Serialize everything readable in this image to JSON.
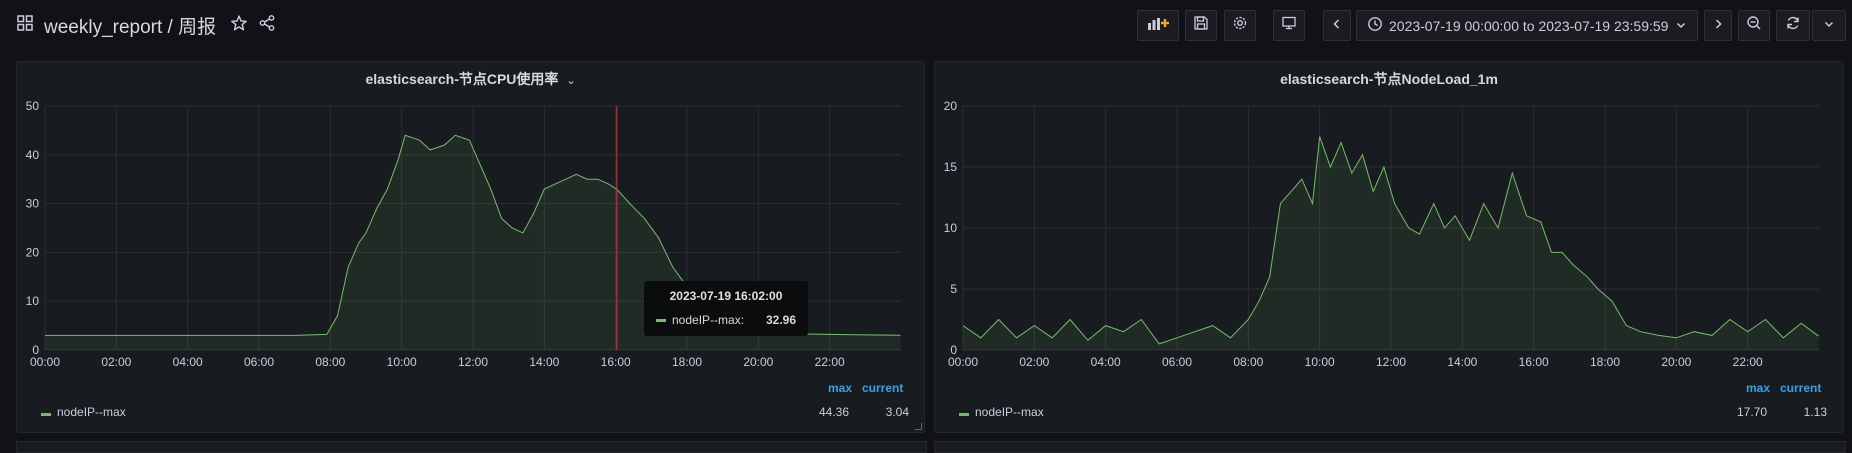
{
  "dashboard": {
    "title": "weekly_report / 周报"
  },
  "toolbar": {
    "time_range": "2023-07-19 00:00:00 to 2023-07-19 23:59:59",
    "icons": [
      "add-panel-icon",
      "save-icon",
      "settings-icon",
      "tv-mode-icon",
      "prev-time-icon",
      "clock-icon",
      "next-time-icon",
      "zoom-out-icon",
      "refresh-icon",
      "refresh-interval-chevron-icon"
    ]
  },
  "colors": {
    "series": "#73bf69",
    "crosshair": "#e02f44",
    "legend_header": "#33a2e5"
  },
  "panels": [
    {
      "title": "elasticsearch-节点CPU使用率",
      "legend": {
        "headers": {
          "max": "max",
          "current": "current"
        },
        "series_name": "nodeIP--max",
        "max": "44.36",
        "current": "3.04"
      },
      "tooltip": {
        "time": "2023-07-19 16:02:00",
        "series": "nodeIP--max:",
        "value": "32.96"
      }
    },
    {
      "title": "elasticsearch-节点NodeLoad_1m",
      "legend": {
        "headers": {
          "max": "max",
          "current": "current"
        },
        "series_name": "nodeIP--max",
        "max": "17.70",
        "current": "1.13"
      }
    }
  ],
  "chart_data": [
    {
      "type": "area",
      "title": "elasticsearch-节点CPU使用率",
      "x_tick_labels": [
        "00:00",
        "02:00",
        "04:00",
        "06:00",
        "08:00",
        "10:00",
        "12:00",
        "14:00",
        "16:00",
        "18:00",
        "20:00",
        "22:00"
      ],
      "y_tick_labels": [
        "0",
        "10",
        "20",
        "30",
        "40",
        "50"
      ],
      "ylim": [
        0,
        50
      ],
      "xlim_hours": [
        0,
        24
      ],
      "grid": true,
      "series": [
        {
          "name": "nodeIP--max",
          "points": [
            [
              0,
              3
            ],
            [
              1,
              3
            ],
            [
              2,
              3
            ],
            [
              3,
              3
            ],
            [
              4,
              3
            ],
            [
              5,
              3
            ],
            [
              6,
              3
            ],
            [
              7,
              3
            ],
            [
              7.9,
              3.2
            ],
            [
              8.2,
              7
            ],
            [
              8.5,
              17
            ],
            [
              8.8,
              22
            ],
            [
              9,
              24
            ],
            [
              9.3,
              29
            ],
            [
              9.6,
              33
            ],
            [
              9.9,
              39
            ],
            [
              10.1,
              44
            ],
            [
              10.5,
              43
            ],
            [
              10.8,
              41
            ],
            [
              11.2,
              42
            ],
            [
              11.5,
              44
            ],
            [
              11.9,
              43
            ],
            [
              12.2,
              38
            ],
            [
              12.5,
              33
            ],
            [
              12.8,
              27
            ],
            [
              13.1,
              25
            ],
            [
              13.4,
              24
            ],
            [
              13.7,
              28
            ],
            [
              14,
              33
            ],
            [
              14.3,
              34
            ],
            [
              14.6,
              35
            ],
            [
              14.9,
              36
            ],
            [
              15.2,
              35
            ],
            [
              15.5,
              35
            ],
            [
              15.8,
              34
            ],
            [
              16.03,
              32.96
            ],
            [
              16.4,
              30
            ],
            [
              16.8,
              27
            ],
            [
              17.2,
              23
            ],
            [
              17.6,
              17
            ],
            [
              18,
              13
            ],
            [
              18.5,
              7
            ],
            [
              19,
              4
            ],
            [
              20,
              3.2
            ],
            [
              21,
              3.3
            ],
            [
              22,
              3.2
            ],
            [
              23,
              3.1
            ],
            [
              23.99,
              3.04
            ]
          ]
        }
      ]
    },
    {
      "type": "area",
      "title": "elasticsearch-节点NodeLoad_1m",
      "x_tick_labels": [
        "00:00",
        "02:00",
        "04:00",
        "06:00",
        "08:00",
        "10:00",
        "12:00",
        "14:00",
        "16:00",
        "18:00",
        "20:00",
        "22:00"
      ],
      "y_tick_labels": [
        "0",
        "5",
        "10",
        "15",
        "20"
      ],
      "ylim": [
        0,
        20
      ],
      "xlim_hours": [
        0,
        24
      ],
      "grid": true,
      "series": [
        {
          "name": "nodeIP--max",
          "points": [
            [
              0,
              2
            ],
            [
              0.5,
              1
            ],
            [
              1,
              2.5
            ],
            [
              1.5,
              1
            ],
            [
              2,
              2
            ],
            [
              2.5,
              1
            ],
            [
              3,
              2.5
            ],
            [
              3.5,
              0.8
            ],
            [
              4,
              2
            ],
            [
              4.5,
              1.5
            ],
            [
              5,
              2.5
            ],
            [
              5.5,
              0.5
            ],
            [
              6,
              1
            ],
            [
              6.5,
              1.5
            ],
            [
              7,
              2
            ],
            [
              7.5,
              1
            ],
            [
              8,
              2.5
            ],
            [
              8.3,
              4
            ],
            [
              8.6,
              6
            ],
            [
              8.9,
              12
            ],
            [
              9.2,
              13
            ],
            [
              9.5,
              14
            ],
            [
              9.8,
              12
            ],
            [
              10,
              17.5
            ],
            [
              10.3,
              15
            ],
            [
              10.6,
              17
            ],
            [
              10.9,
              14.5
            ],
            [
              11.2,
              16
            ],
            [
              11.5,
              13
            ],
            [
              11.8,
              15
            ],
            [
              12.1,
              12
            ],
            [
              12.5,
              10
            ],
            [
              12.8,
              9.5
            ],
            [
              13.2,
              12
            ],
            [
              13.5,
              10
            ],
            [
              13.8,
              11
            ],
            [
              14.2,
              9
            ],
            [
              14.6,
              12
            ],
            [
              15,
              10
            ],
            [
              15.4,
              14.5
            ],
            [
              15.8,
              11
            ],
            [
              16.2,
              10.5
            ],
            [
              16.5,
              8
            ],
            [
              16.8,
              8
            ],
            [
              17.1,
              7
            ],
            [
              17.5,
              6
            ],
            [
              17.8,
              5
            ],
            [
              18.2,
              4
            ],
            [
              18.6,
              2
            ],
            [
              19,
              1.5
            ],
            [
              19.5,
              1.2
            ],
            [
              20,
              1
            ],
            [
              20.5,
              1.5
            ],
            [
              21,
              1.2
            ],
            [
              21.5,
              2.5
            ],
            [
              22,
              1.5
            ],
            [
              22.5,
              2.5
            ],
            [
              23,
              1
            ],
            [
              23.5,
              2.2
            ],
            [
              23.99,
              1.13
            ]
          ]
        }
      ]
    }
  ]
}
